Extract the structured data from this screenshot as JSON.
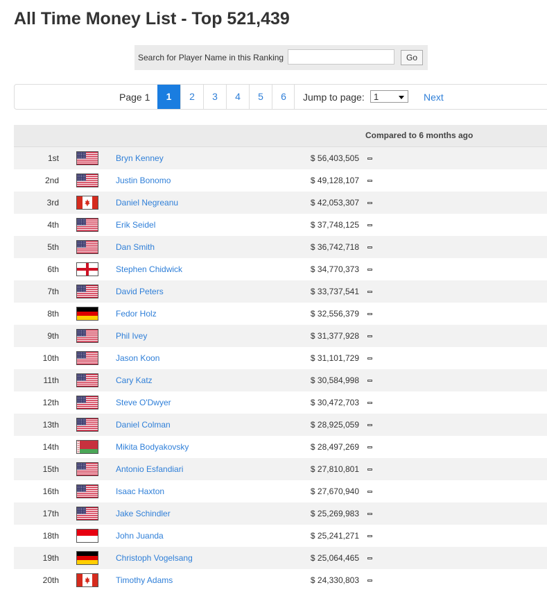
{
  "title": "All Time Money List - Top 521,439",
  "search": {
    "label": "Search for Player Name in this Ranking",
    "value": "",
    "button": "Go"
  },
  "pagination": {
    "label": "Page 1",
    "pages": [
      "1",
      "2",
      "3",
      "4",
      "5",
      "6"
    ],
    "active": "1",
    "jump_label": "Jump to page:",
    "jump_value": "1",
    "next": "Next"
  },
  "table": {
    "compare_header": "Compared to 6 months ago",
    "rows": [
      {
        "rank": "1st",
        "flag": "us-flag-icon",
        "name": "Bryn Kenney",
        "money": "$ 56,403,505"
      },
      {
        "rank": "2nd",
        "flag": "us-flag-icon",
        "name": "Justin Bonomo",
        "money": "$ 49,128,107"
      },
      {
        "rank": "3rd",
        "flag": "canada-flag-icon",
        "name": "Daniel Negreanu",
        "money": "$ 42,053,307"
      },
      {
        "rank": "4th",
        "flag": "us-flag-icon",
        "name": "Erik Seidel",
        "money": "$ 37,748,125"
      },
      {
        "rank": "5th",
        "flag": "us-flag-icon",
        "name": "Dan Smith",
        "money": "$ 36,742,718"
      },
      {
        "rank": "6th",
        "flag": "england-flag-icon",
        "name": "Stephen Chidwick",
        "money": "$ 34,770,373"
      },
      {
        "rank": "7th",
        "flag": "us-flag-icon",
        "name": "David Peters",
        "money": "$ 33,737,541"
      },
      {
        "rank": "8th",
        "flag": "germany-flag-icon",
        "name": "Fedor Holz",
        "money": "$ 32,556,379"
      },
      {
        "rank": "9th",
        "flag": "us-flag-icon",
        "name": "Phil Ivey",
        "money": "$ 31,377,928"
      },
      {
        "rank": "10th",
        "flag": "us-flag-icon",
        "name": "Jason Koon",
        "money": "$ 31,101,729"
      },
      {
        "rank": "11th",
        "flag": "us-flag-icon",
        "name": "Cary Katz",
        "money": "$ 30,584,998"
      },
      {
        "rank": "12th",
        "flag": "us-flag-icon",
        "name": "Steve O'Dwyer",
        "money": "$ 30,472,703"
      },
      {
        "rank": "13th",
        "flag": "us-flag-icon",
        "name": "Daniel Colman",
        "money": "$ 28,925,059"
      },
      {
        "rank": "14th",
        "flag": "belarus-flag-icon",
        "name": "Mikita Bodyakovsky",
        "money": "$ 28,497,269"
      },
      {
        "rank": "15th",
        "flag": "us-flag-icon",
        "name": "Antonio Esfandiari",
        "money": "$ 27,810,801"
      },
      {
        "rank": "16th",
        "flag": "us-flag-icon",
        "name": "Isaac Haxton",
        "money": "$ 27,670,940"
      },
      {
        "rank": "17th",
        "flag": "us-flag-icon",
        "name": "Jake Schindler",
        "money": "$ 25,269,983"
      },
      {
        "rank": "18th",
        "flag": "indonesia-flag-icon",
        "name": "John Juanda",
        "money": "$ 25,241,271"
      },
      {
        "rank": "19th",
        "flag": "germany-flag-icon",
        "name": "Christoph Vogelsang",
        "money": "$ 25,064,465"
      },
      {
        "rank": "20th",
        "flag": "canada-flag-icon",
        "name": "Timothy Adams",
        "money": "$ 24,330,803"
      }
    ]
  },
  "colors": {
    "link": "#2f7fd8",
    "active_page": "#1a7de0"
  }
}
